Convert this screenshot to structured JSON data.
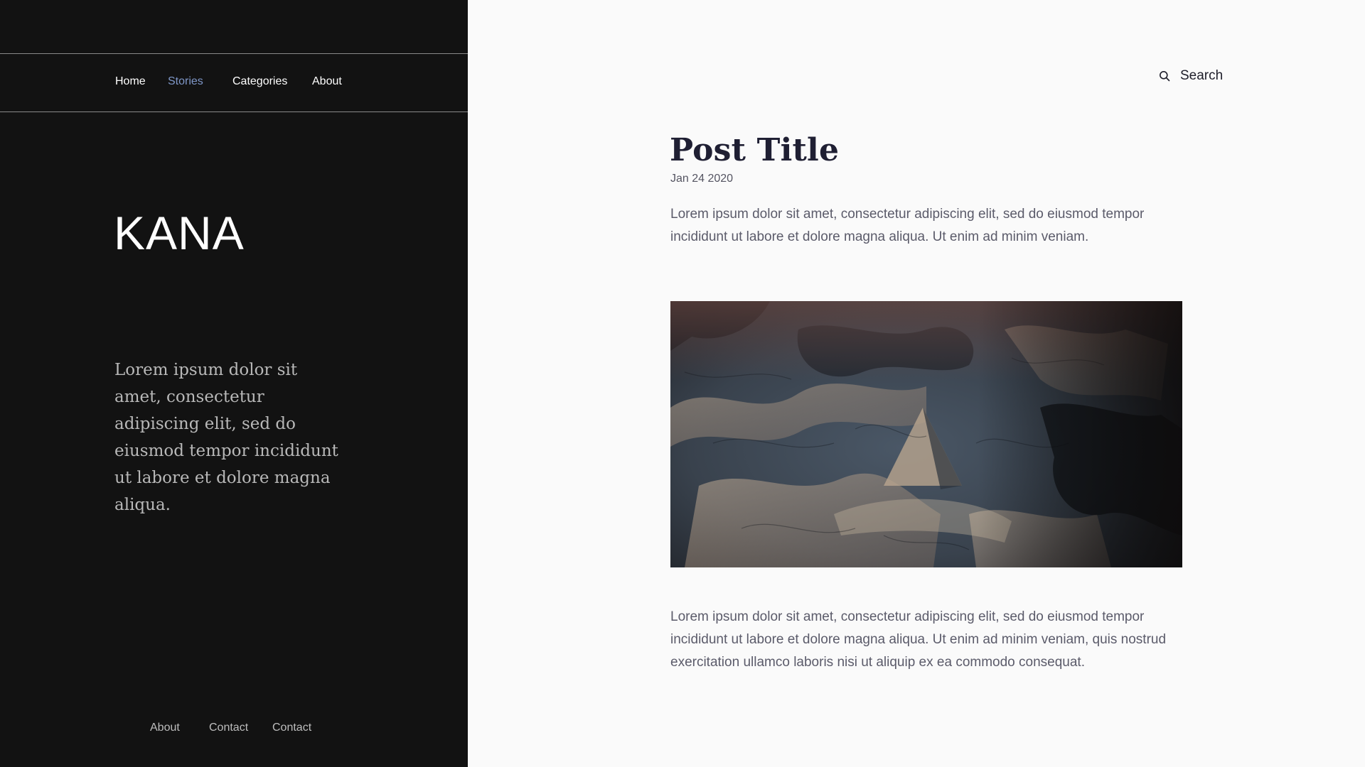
{
  "nav": {
    "items": [
      {
        "label": "Home"
      },
      {
        "label": "Stories"
      },
      {
        "label": "Categories"
      },
      {
        "label": "About"
      }
    ],
    "active": "Stories",
    "active_color": "#7f97c8"
  },
  "brand": {
    "name": "KANA"
  },
  "sidebar": {
    "intro": "Lorem ipsum dolor sit amet, consectetur adipiscing elit, sed do eiusmod tempor incididunt ut labore et dolore magna aliqua.",
    "background": "#121212"
  },
  "footer": {
    "links": [
      {
        "label": "About"
      },
      {
        "label": "Contact"
      },
      {
        "label": "Contact"
      }
    ]
  },
  "search": {
    "label": "Search",
    "icon": "search-icon"
  },
  "post": {
    "title": "Post Title",
    "date": "Jan 24 2020",
    "lead": "Lorem ipsum dolor sit amet, consectetur adipiscing elit, sed do eiusmod tempor incididunt ut labore et dolore magna aliqua. Ut enim ad minim veniam.",
    "body": "Lorem ipsum dolor sit amet, consectetur adipiscing elit, sed do eiusmod tempor incididunt ut labore et dolore magna aliqua. Ut enim ad minim veniam, quis nostrud exercitation ullamco laboris nisi ut aliquip ex ea commodo consequat."
  }
}
